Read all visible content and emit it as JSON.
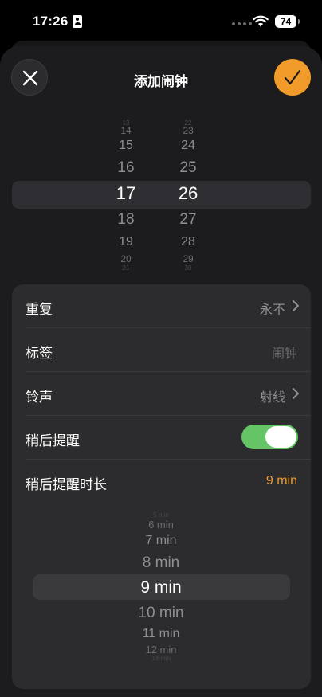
{
  "status_bar": {
    "time": "17:26",
    "battery": "74",
    "icons": [
      "contact-card-icon",
      "signal-dots-icon",
      "wifi-icon",
      "battery-icon"
    ]
  },
  "header": {
    "title": "添加闹钟",
    "close_icon": "close-icon",
    "confirm_icon": "checkmark-icon"
  },
  "time_picker": {
    "hours": [
      "13",
      "14",
      "15",
      "16",
      "17",
      "18",
      "19",
      "20",
      "21"
    ],
    "minutes": [
      "22",
      "23",
      "24",
      "25",
      "26",
      "27",
      "28",
      "29",
      "30"
    ],
    "selected_hour": "17",
    "selected_minute": "26"
  },
  "settings": {
    "repeat": {
      "label": "重复",
      "value": "永不"
    },
    "label": {
      "label": "标签",
      "placeholder": "闹钟"
    },
    "sound": {
      "label": "铃声",
      "value": "射线"
    },
    "snooze": {
      "label": "稍后提醒",
      "enabled": true
    },
    "snooze_duration": {
      "label": "稍后提醒时长",
      "value": "9 min"
    }
  },
  "snooze_picker": {
    "options": [
      "5 min",
      "6 min",
      "7 min",
      "8 min",
      "9 min",
      "10 min",
      "11 min",
      "12 min",
      "13 min"
    ],
    "selected": "9 min"
  },
  "colors": {
    "accent": "#f19b2a",
    "toggle_on": "#65c466",
    "sheet": "#1c1c1e",
    "card": "#2c2c2e"
  }
}
